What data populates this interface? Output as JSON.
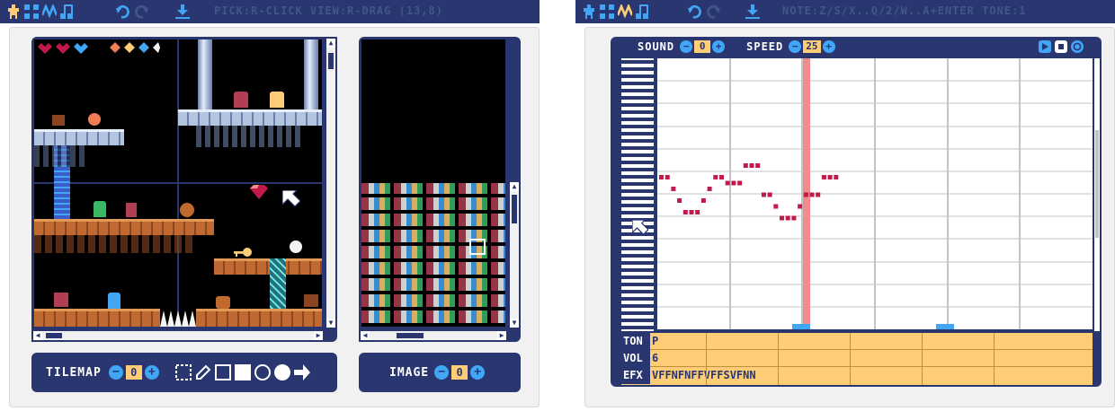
{
  "colors": {
    "navy": "#29366f",
    "accent_blue": "#41a6f6",
    "highlight": "#ffcd75",
    "note": "#c0194a",
    "playhead": "#f28c8c",
    "status_text": "#41568a"
  },
  "menu_icons": [
    "person-icon",
    "grid-icon",
    "wave-icon",
    "music-note-icon"
  ],
  "left": {
    "status": "PICK:R-CLICK VIEW:R-DRAG (13,8)",
    "tilemap_toolbar": {
      "label": "TILEMAP",
      "value": "0",
      "tools": [
        "select-tool-icon",
        "pencil-tool-icon",
        "rect-outline-tool-icon",
        "rect-fill-tool-icon",
        "circle-outline-tool-icon",
        "circle-fill-tool-icon",
        "fill-bucket-tool-icon"
      ]
    },
    "image_toolbar": {
      "label": "IMAGE",
      "value": "0"
    }
  },
  "right": {
    "status": "NOTE:Z/S/X..Q/2/W..A+ENTER TONE:1",
    "sound": {
      "label": "SOUND",
      "value": "0"
    },
    "speed": {
      "label": "SPEED",
      "value": "25"
    },
    "rows": [
      {
        "label": "TON",
        "value": "P"
      },
      {
        "label": "VOL",
        "value": "6"
      },
      {
        "label": "EFX",
        "value": "VFFNFNFFVFFSVFNN"
      }
    ],
    "notes": [
      0,
      0,
      -2,
      -4,
      -6,
      -6,
      -6,
      -4,
      -2,
      0,
      0,
      -1,
      -1,
      -1,
      2,
      2,
      2,
      -3,
      -3,
      -5,
      -7,
      -7,
      -7,
      -5,
      -3,
      -3,
      -3,
      0,
      0,
      0
    ]
  }
}
